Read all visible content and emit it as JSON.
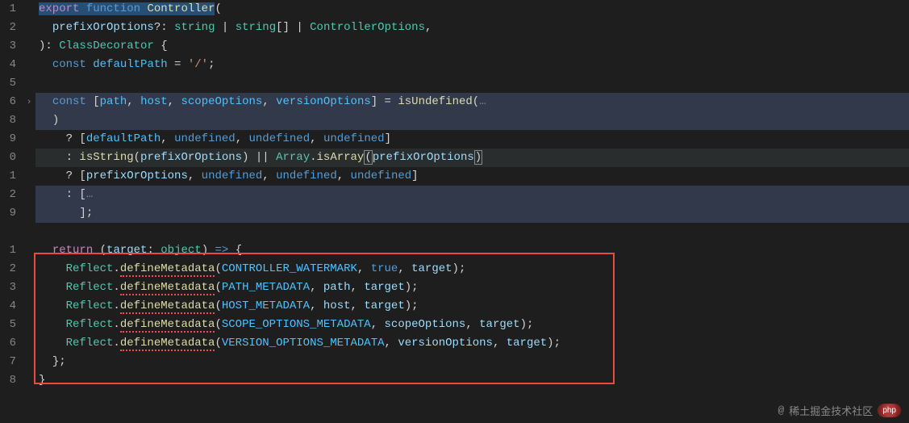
{
  "line_numbers": [
    "1",
    "2",
    "3",
    "4",
    "5",
    "6",
    "8",
    "9",
    "0",
    "1",
    "2",
    "9",
    "",
    "1",
    "2",
    "3",
    "4",
    "5",
    "6",
    "7",
    "8",
    ""
  ],
  "fold_markers": {
    "5": "›"
  },
  "code": {
    "l1": {
      "export": "export",
      "function": "function",
      "name": "Controller",
      "open": "("
    },
    "l2": {
      "indent": "  ",
      "param": "prefixOrOptions",
      "opt": "?:",
      "t1": "string",
      "p1": " | ",
      "t2": "string",
      "arr": "[]",
      "p2": " | ",
      "t3": "ControllerOptions",
      "comma": ","
    },
    "l3": {
      "close": "): ",
      "ret": "ClassDecorator",
      "brace": " {"
    },
    "l4": {
      "indent": "  ",
      "const": "const",
      "var": "defaultPath",
      "eq": " = ",
      "str": "'/'",
      ";": ";"
    },
    "l5": {
      "text": ""
    },
    "l6": {
      "indent": "  ",
      "const": "const",
      "open": " [",
      "v1": "path",
      "c1": ", ",
      "v2": "host",
      "c2": ", ",
      "v3": "scopeOptions",
      "c3": ", ",
      "v4": "versionOptions",
      "close": "] = ",
      "fn": "isUndefined",
      "p": "(",
      "ell": "…"
    },
    "l7": {
      "indent": "  ",
      "close": ")"
    },
    "l8": {
      "indent": "    ",
      "q": "? [",
      "v1": "defaultPath",
      "c1": ", ",
      "u1": "undefined",
      "c2": ", ",
      "u2": "undefined",
      "c3": ", ",
      "u3": "undefined",
      "close": "]"
    },
    "l9": {
      "indent": "    ",
      "colon": ": ",
      "fn1": "isString",
      "p1": "(",
      "v1": "prefixOrOptions",
      "p2": ") || ",
      "cls": "Array",
      "dot": ".",
      "fn2": "isArray",
      "p3": "(",
      "v2": "prefixOrOptions",
      "p4": ")"
    },
    "l10": {
      "indent": "    ",
      "q": "? [",
      "v1": "prefixOrOptions",
      "c1": ", ",
      "u1": "undefined",
      "c2": ", ",
      "u2": "undefined",
      "c3": ", ",
      "u3": "undefined",
      "close": "]"
    },
    "l11": {
      "indent": "    ",
      "colon": ": [",
      "ell": "…"
    },
    "l12": {
      "indent": "      ",
      "close": "];"
    },
    "l13": {
      "text": ""
    },
    "l14": {
      "indent": "  ",
      "return": "return",
      "sp": " (",
      "param": "target",
      "colon": ": ",
      "type": "object",
      "close": ") ",
      "arrow": "=>",
      "brace": " {"
    },
    "l15": {
      "indent": "    ",
      "obj": "Reflect",
      "dot": ".",
      "fn": "defineMetadata",
      "p1": "(",
      "c1": "CONTROLLER_WATERMARK",
      "cm": ", ",
      "v": "true",
      "cm2": ", ",
      "t": "target",
      "p2": ");"
    },
    "l16": {
      "indent": "    ",
      "obj": "Reflect",
      "dot": ".",
      "fn": "defineMetadata",
      "p1": "(",
      "c1": "PATH_METADATA",
      "cm": ", ",
      "v": "path",
      "cm2": ", ",
      "t": "target",
      "p2": ");"
    },
    "l17": {
      "indent": "    ",
      "obj": "Reflect",
      "dot": ".",
      "fn": "defineMetadata",
      "p1": "(",
      "c1": "HOST_METADATA",
      "cm": ", ",
      "v": "host",
      "cm2": ", ",
      "t": "target",
      "p2": ");"
    },
    "l18": {
      "indent": "    ",
      "obj": "Reflect",
      "dot": ".",
      "fn": "defineMetadata",
      "p1": "(",
      "c1": "SCOPE_OPTIONS_METADATA",
      "cm": ", ",
      "v": "scopeOptions",
      "cm2": ", ",
      "t": "target",
      "p2": ");"
    },
    "l19": {
      "indent": "    ",
      "obj": "Reflect",
      "dot": ".",
      "fn": "defineMetadata",
      "p1": "(",
      "c1": "VERSION_OPTIONS_METADATA",
      "cm": ", ",
      "v": "versionOptions",
      "cm2": ", ",
      "t": "target",
      "p2": ");"
    },
    "l20": {
      "indent": "  ",
      "close": "};"
    },
    "l21": {
      "close": "}"
    }
  },
  "watermark": {
    "at": "@",
    "text": "稀土掘金技术社区",
    "logo": "php"
  }
}
